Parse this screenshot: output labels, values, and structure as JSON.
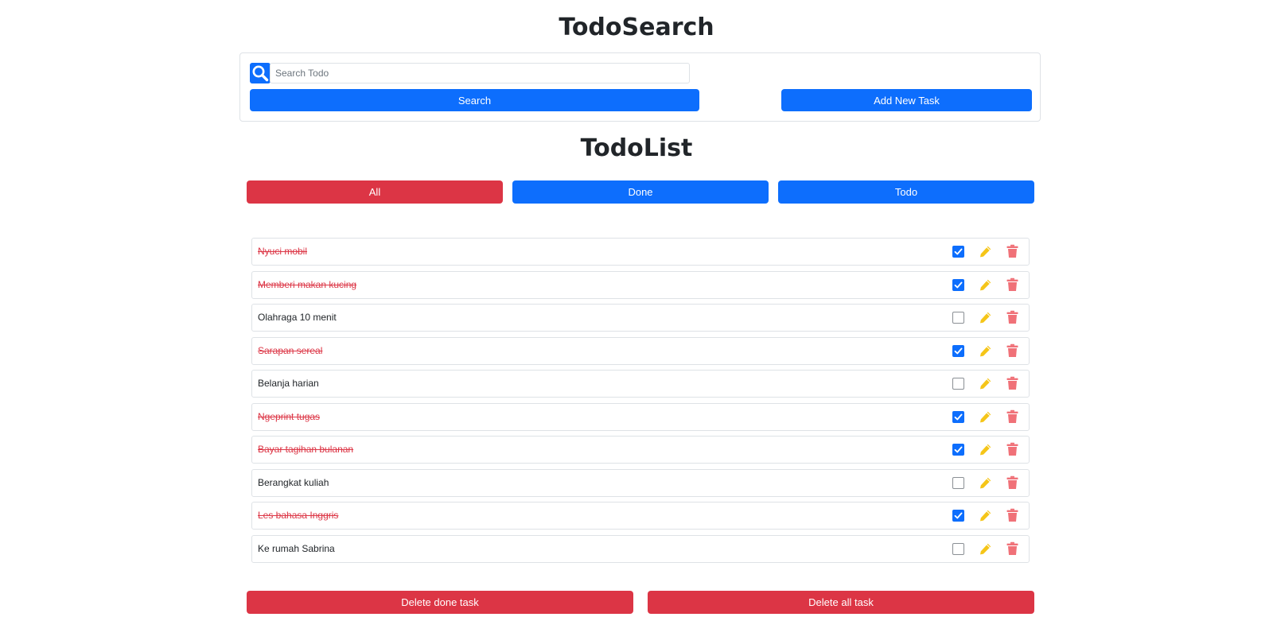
{
  "header": {
    "title": "TodoSearch"
  },
  "search": {
    "placeholder": "Search Todo",
    "value": "",
    "search_label": "Search",
    "add_label": "Add New Task"
  },
  "list": {
    "title": "TodoList",
    "filters": [
      {
        "label": "All",
        "active": true
      },
      {
        "label": "Done",
        "active": false
      },
      {
        "label": "Todo",
        "active": false
      }
    ],
    "items": [
      {
        "text": "Nyuci mobil",
        "done": true
      },
      {
        "text": "Memberi makan kucing",
        "done": true
      },
      {
        "text": "Olahraga 10 menit",
        "done": false
      },
      {
        "text": "Sarapan sereal",
        "done": true
      },
      {
        "text": "Belanja harian",
        "done": false
      },
      {
        "text": "Ngeprint tugas",
        "done": true
      },
      {
        "text": "Bayar tagihan bulanan",
        "done": true
      },
      {
        "text": "Berangkat kuliah",
        "done": false
      },
      {
        "text": "Les bahasa Inggris",
        "done": true
      },
      {
        "text": "Ke rumah Sabrina",
        "done": false
      }
    ]
  },
  "footer": {
    "delete_done_label": "Delete done task",
    "delete_all_label": "Delete all task"
  },
  "colors": {
    "primary": "#0d6efd",
    "danger": "#dc3545",
    "edit": "#f5c518",
    "trash": "#f07178"
  },
  "icons": {
    "search": "search-icon",
    "edit": "pencil-icon",
    "delete": "trash-icon",
    "check": "checkbox"
  }
}
